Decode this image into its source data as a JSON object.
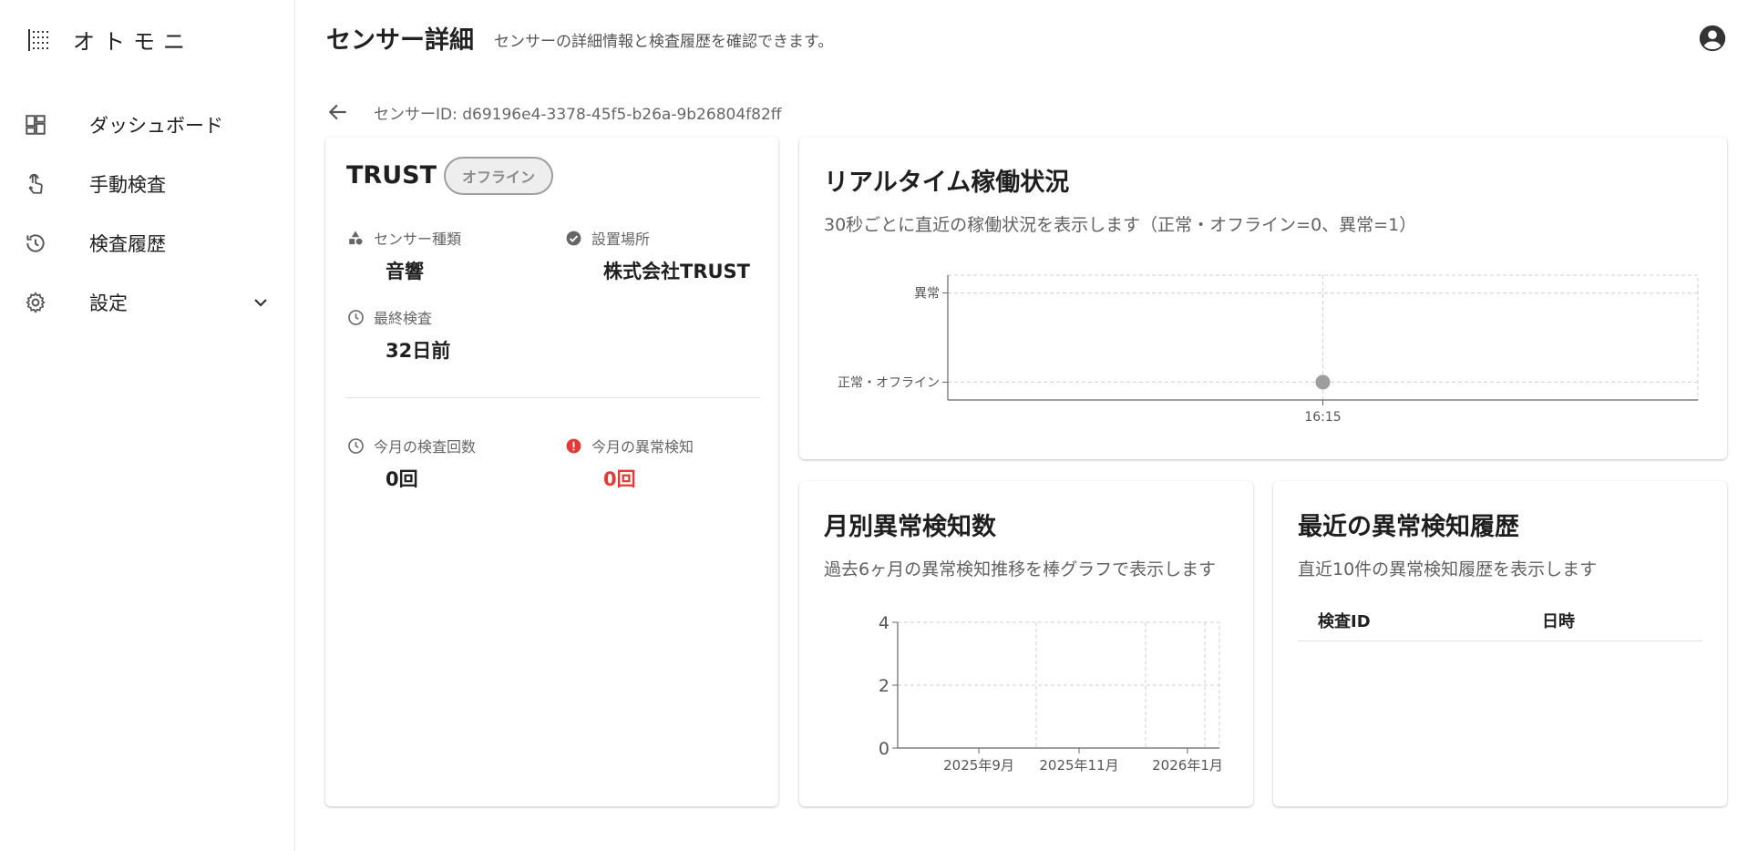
{
  "app": {
    "name": "オトモニ"
  },
  "nav": {
    "items": [
      {
        "label": "ダッシュボード",
        "icon": "dashboard-icon"
      },
      {
        "label": "手動検査",
        "icon": "touch-icon"
      },
      {
        "label": "検査履歴",
        "icon": "history-icon"
      },
      {
        "label": "設定",
        "icon": "gear-icon"
      }
    ]
  },
  "header": {
    "title": "センサー詳細",
    "subtitle": "センサーの詳細情報と検査履歴を確認できます。"
  },
  "sensor": {
    "id_text": "センサーID: d69196e4-3378-45f5-b26a-9b26804f82ff",
    "name": "TRUST",
    "status": "オフライン",
    "type_label": "センサー種類",
    "type_value": "音響",
    "location_label": "設置場所",
    "location_value": "株式会社TRUST",
    "last_check_label": "最終検査",
    "last_check_value": "32日前",
    "monthly_checks_label": "今月の検査回数",
    "monthly_checks_value": "0回",
    "monthly_anomalies_label": "今月の異常検知",
    "monthly_anomalies_value": "0回"
  },
  "colors": {
    "anomaly": "#e53935",
    "status_grey": "#9e9e9e",
    "point": "#9e9e9e"
  },
  "realtime": {
    "title": "リアルタイム稼働状況",
    "desc": "30秒ごとに直近の稼働状況を表示します（正常・オフライン=0、異常=1）"
  },
  "monthly": {
    "title": "月別異常検知数",
    "desc": "過去6ヶ月の異常検知推移を棒グラフで表示します"
  },
  "history": {
    "title": "最近の異常検知履歴",
    "desc": "直近10件の異常検知履歴を表示します",
    "columns": [
      "検査ID",
      "日時"
    ]
  },
  "chart_data": [
    {
      "type": "scatter",
      "x": [
        "16:15"
      ],
      "values": [
        0
      ],
      "y_ticks": [
        {
          "value": 1,
          "label": "異常"
        },
        {
          "value": 0,
          "label": "正常・オフライン"
        }
      ],
      "ylim": [
        -0.2,
        1.2
      ],
      "grid": true
    },
    {
      "type": "bar",
      "categories": [
        "2025年9月",
        "2025年11月",
        "2026年1月"
      ],
      "values": [
        0,
        0,
        0
      ],
      "y_ticks": [
        0,
        2,
        4
      ],
      "ylim": [
        0,
        4
      ],
      "grid": true
    }
  ]
}
